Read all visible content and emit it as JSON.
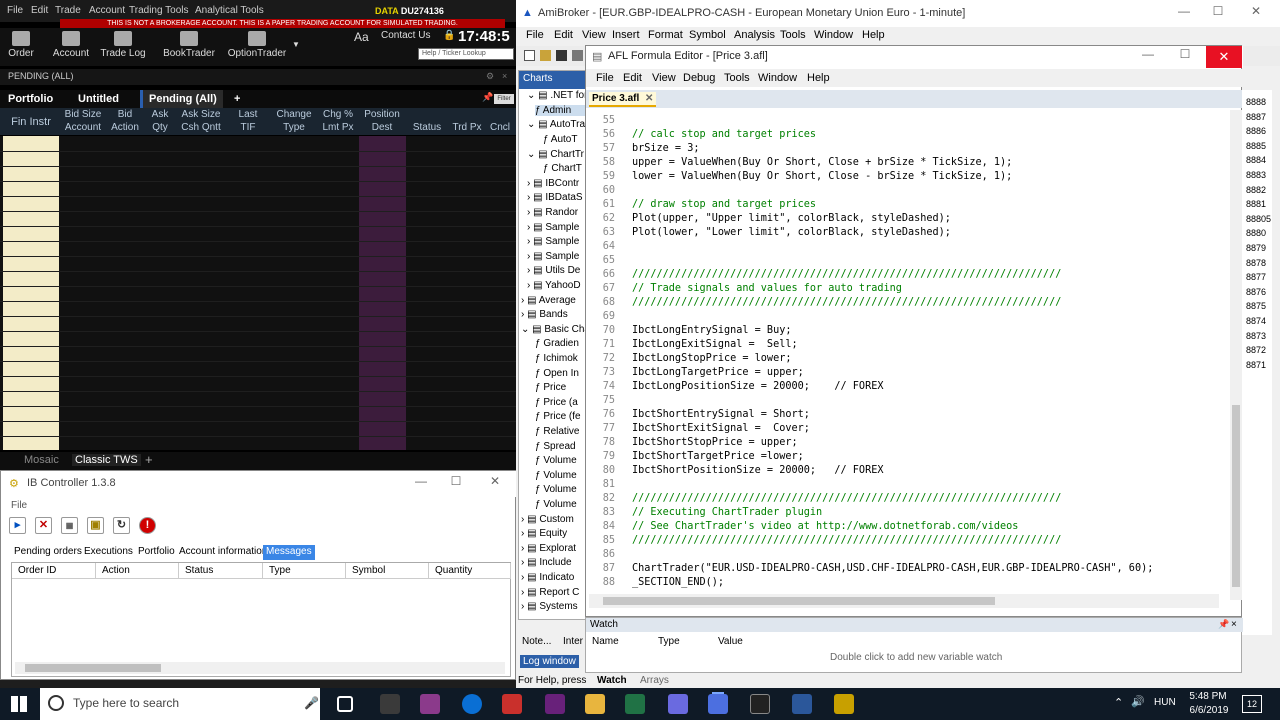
{
  "tws": {
    "menu": [
      "File",
      "Edit",
      "Trade",
      "Account",
      "Trading Tools",
      "Analytical Tools"
    ],
    "warning": "THIS IS NOT A BROKERAGE ACCOUNT. THIS IS A PAPER TRADING ACCOUNT FOR SIMULATED TRADING.",
    "data_label": "DATA",
    "account_id": "DU274136",
    "time": "17:48:5",
    "aa": "Aa",
    "contact": "Contact Us",
    "ticker_lookup_placeholder": "Help / Ticker Lookup",
    "toolbar": [
      {
        "label": "Order",
        "icon": "order-icon"
      },
      {
        "label": "Account",
        "icon": "account-icon"
      },
      {
        "label": "Trade Log",
        "icon": "trade-log-icon"
      },
      {
        "label": "BookTrader",
        "icon": "booktrader-icon"
      },
      {
        "label": "OptionTrader",
        "icon": "optiontrader-icon"
      }
    ],
    "pending_header": "PENDING (ALL)",
    "tabs": [
      "Portfolio",
      "Untitled",
      "Pending (All)",
      "+"
    ],
    "filter": "Filter",
    "columns": [
      "Fin Instr",
      "Bid Size",
      "Bid",
      "Ask",
      "Ask Size",
      "Last",
      "Change",
      "Chg %",
      "Position",
      "Status",
      "Trd Px",
      "Cncl"
    ],
    "columns2": [
      "Account",
      "Action",
      "Qty",
      "Csh Qntt",
      "TIF",
      "Type",
      "Lmt Px",
      "Dest"
    ],
    "bottom_tabs": [
      "Mosaic",
      "Classic TWS",
      "+"
    ]
  },
  "ibc": {
    "title": "IB Controller 1.3.8",
    "file": "File",
    "tabs": [
      "Pending orders",
      "Executions",
      "Portfolio",
      "Account information",
      "Messages"
    ],
    "columns": [
      "Order ID",
      "Action",
      "Status",
      "Type",
      "Symbol",
      "Quantity"
    ]
  },
  "ami": {
    "title": "AmiBroker - [EUR.GBP-IDEALPRO-CASH - European Monetary Union Euro - 1-minute]",
    "menu": [
      "File",
      "Edit",
      "View",
      "Insert",
      "Format",
      "Symbol",
      "Analysis",
      "Tools",
      "Window",
      "Help"
    ],
    "charts_header": "Charts",
    "tree": [
      ".NET for",
      "Admin",
      "AutoTra",
      "AutoT",
      "ChartTr",
      "ChartT",
      "IBContr",
      "IBDataS",
      "Randor",
      "Sample",
      "Sample",
      "Sample",
      "Utils De",
      "YahooD",
      "Average",
      "Bands",
      "Basic Cha",
      "Gradien",
      "Ichimok",
      "Open In",
      "Price",
      "Price (a",
      "Price (fe",
      "Relative",
      "Spread",
      "Volume",
      "Volume",
      "Volume",
      "Volume",
      "Custom",
      "Equity",
      "Explorat",
      "Include",
      "Indicato",
      "Report C",
      "Systems"
    ],
    "bottom_tabs": [
      "Note...",
      "Inter"
    ],
    "log_window": "Log window",
    "status": "For Help, press",
    "price_axis": [
      "8888",
      "8887",
      "8886",
      "8885",
      "8884",
      "8883",
      "8882",
      "8881",
      "88805",
      "8880",
      "8879",
      "8878",
      "8877",
      "8876",
      "8875",
      "8874",
      "8873",
      "8872",
      "8871"
    ]
  },
  "afl": {
    "title": "AFL Formula Editor - [Price 3.afl]",
    "menu": [
      "File",
      "Edit",
      "View",
      "Debug",
      "Tools",
      "Window",
      "Help"
    ],
    "tab": "Price 3.afl",
    "lines": [
      {
        "n": "55",
        "t": ""
      },
      {
        "n": "56",
        "t": "// calc stop and target prices",
        "c": "c-cm"
      },
      {
        "n": "57",
        "t": "brSize = 3;"
      },
      {
        "n": "58",
        "t": "upper = ValueWhen(Buy Or Short, Close + brSize * TickSize, 1);"
      },
      {
        "n": "59",
        "t": "lower = ValueWhen(Buy Or Short, Close - brSize * TickSize, 1);"
      },
      {
        "n": "60",
        "t": ""
      },
      {
        "n": "61",
        "t": "// draw stop and target prices",
        "c": "c-cm"
      },
      {
        "n": "62",
        "t": "Plot(upper, \"Upper limit\", colorBlack, styleDashed);"
      },
      {
        "n": "63",
        "t": "Plot(lower, \"Lower limit\", colorBlack, styleDashed);"
      },
      {
        "n": "64",
        "t": ""
      },
      {
        "n": "65",
        "t": ""
      },
      {
        "n": "66",
        "t": "//////////////////////////////////////////////////////////////////////",
        "c": "c-cm"
      },
      {
        "n": "67",
        "t": "// Trade signals and values for auto trading",
        "c": "c-cm"
      },
      {
        "n": "68",
        "t": "//////////////////////////////////////////////////////////////////////",
        "c": "c-cm"
      },
      {
        "n": "69",
        "t": ""
      },
      {
        "n": "70",
        "t": "IbctLongEntrySignal = Buy;"
      },
      {
        "n": "71",
        "t": "IbctLongExitSignal =  Sell;"
      },
      {
        "n": "72",
        "t": "IbctLongStopPrice = lower;"
      },
      {
        "n": "73",
        "t": "IbctLongTargetPrice = upper;"
      },
      {
        "n": "74",
        "t": "IbctLongPositionSize = 20000;    // FOREX"
      },
      {
        "n": "75",
        "t": ""
      },
      {
        "n": "76",
        "t": "IbctShortEntrySignal = Short;"
      },
      {
        "n": "77",
        "t": "IbctShortExitSignal =  Cover;"
      },
      {
        "n": "78",
        "t": "IbctShortStopPrice = upper;"
      },
      {
        "n": "79",
        "t": "IbctShortTargetPrice =lower;"
      },
      {
        "n": "80",
        "t": "IbctShortPositionSize = 20000;   // FOREX"
      },
      {
        "n": "81",
        "t": ""
      },
      {
        "n": "82",
        "t": "//////////////////////////////////////////////////////////////////////",
        "c": "c-cm"
      },
      {
        "n": "83",
        "t": "// Executing ChartTrader plugin",
        "c": "c-cm"
      },
      {
        "n": "84",
        "t": "// See ChartTrader's video at http://www.dotnetforab.com/videos",
        "c": "c-cm"
      },
      {
        "n": "85",
        "t": "//////////////////////////////////////////////////////////////////////",
        "c": "c-cm"
      },
      {
        "n": "86",
        "t": ""
      },
      {
        "n": "87",
        "t": "ChartTrader(\"EUR.USD-IDEALPRO-CASH,USD.CHF-IDEALPRO-CASH,EUR.GBP-IDEALPRO-CASH\", 60);"
      },
      {
        "n": "88",
        "t": "_SECTION_END();"
      }
    ]
  },
  "watch": {
    "title": "Watch",
    "columns": [
      "Name",
      "Type",
      "Value"
    ],
    "hint": "Double click to add new variable watch",
    "tabs": [
      "Watch",
      "Arrays"
    ]
  },
  "taskbar": {
    "search_placeholder": "Type here to search",
    "lang": "HUN",
    "time": "5:48 PM",
    "date": "6/6/2019",
    "notif_count": "12"
  },
  "colors": {
    "tws_warning": "#b00000",
    "ami_close_hover": "#e81123",
    "taskbar": "#0f1a26"
  }
}
